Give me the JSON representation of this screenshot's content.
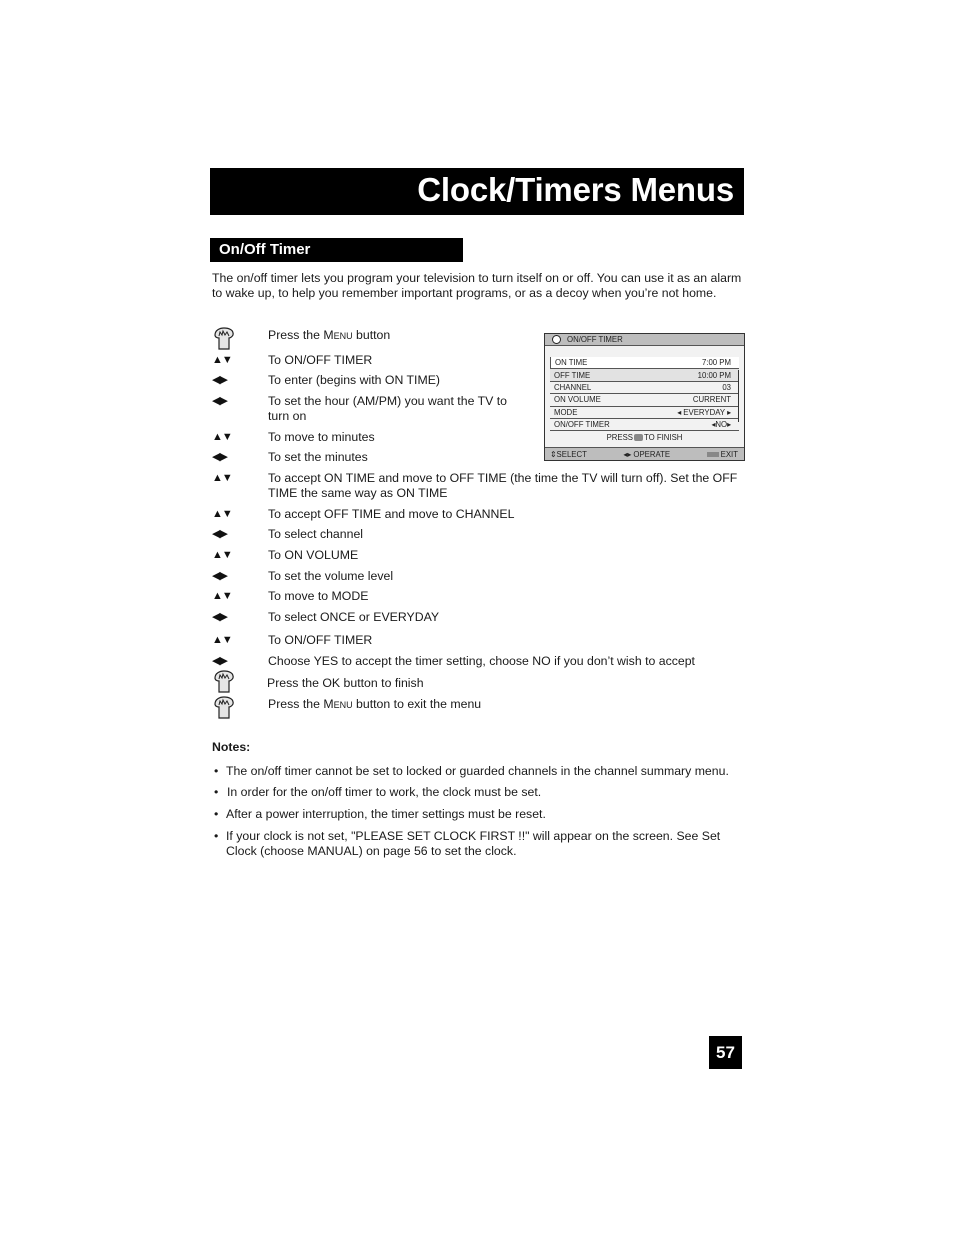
{
  "header": {
    "title": "Clock/Timers Menus"
  },
  "section": {
    "title": "On/Off Timer"
  },
  "intro": "The on/off timer lets you program your television to turn itself on or off. You can use it as an alarm to wake up, to help you remember important programs, or as a decoy when you’re not home.",
  "steps": [
    {
      "icon": "hand-press-icon",
      "text_pre": "Press the ",
      "text_sc": "Menu",
      "text_post": " button"
    },
    {
      "icon": "up-down-arrows-icon",
      "text": "To ON/OFF TIMER"
    },
    {
      "icon": "left-right-arrows-icon",
      "text": "To enter (begins with ON TIME)"
    },
    {
      "icon": "left-right-arrows-icon",
      "text": "To set the hour (AM/PM) you want the TV to turn on"
    },
    {
      "icon": "up-down-arrows-icon",
      "text": "To move to minutes"
    },
    {
      "icon": "left-right-arrows-icon",
      "text": "To set the minutes"
    },
    {
      "icon": "up-down-arrows-icon",
      "text": "To accept ON TIME and move to OFF TIME (the time the TV will turn off). Set the OFF TIME the same way as ON TIME"
    },
    {
      "icon": "up-down-arrows-icon",
      "text": "To accept OFF TIME and move to CHANNEL"
    },
    {
      "icon": "left-right-arrows-icon",
      "text": "To select channel"
    },
    {
      "icon": "up-down-arrows-icon",
      "text": "To ON VOLUME"
    },
    {
      "icon": "left-right-arrows-icon",
      "text": "To set the volume level"
    },
    {
      "icon": "up-down-arrows-icon",
      "text": "To move to MODE"
    },
    {
      "icon": "left-right-arrows-icon",
      "text": "To select ONCE or EVERYDAY"
    },
    {
      "icon": "up-down-arrows-icon",
      "text": "To ON/OFF TIMER"
    },
    {
      "icon": "left-right-arrows-icon",
      "text": "Choose YES to accept the timer setting, choose NO if you don’t wish to accept"
    },
    {
      "icon": "hand-press-icon",
      "text": "Press the OK button to finish"
    },
    {
      "icon": "hand-press-icon",
      "text_pre": "Press the ",
      "text_sc": "Menu",
      "text_post": " button to exit the menu"
    }
  ],
  "glyphs": {
    "up_down": "▲▼",
    "left_right": "◀▶"
  },
  "menu_screen": {
    "title": "ON/OFF TIMER",
    "rows": [
      {
        "label": "ON TIME",
        "value": "7:00 PM"
      },
      {
        "label": "OFF TIME",
        "value": "10:00 PM"
      },
      {
        "label": "CHANNEL",
        "value": "03"
      },
      {
        "label": "ON VOLUME",
        "value": "CURRENT"
      },
      {
        "label": "MODE",
        "value": "EVERYDAY"
      },
      {
        "label": "ON/OFF TIMER",
        "value": "NO"
      }
    ],
    "press_pre": "PRESS",
    "press_post": "TO FINISH",
    "footer": {
      "select": "SELECT",
      "operate": "OPERATE",
      "exit": "EXIT"
    }
  },
  "notes": {
    "title": "Notes:",
    "items": [
      "The on/off timer cannot be set to locked or guarded channels in the channel summary menu.",
      "In order for the on/off timer to work, the clock must be set.",
      "After a power interruption, the timer settings must be reset.",
      "If your clock is not set, \"PLEASE SET CLOCK FIRST !!\" will appear on the screen.  See Set Clock (choose MANUAL) on page 56 to set the clock."
    ]
  },
  "page_number": "57"
}
